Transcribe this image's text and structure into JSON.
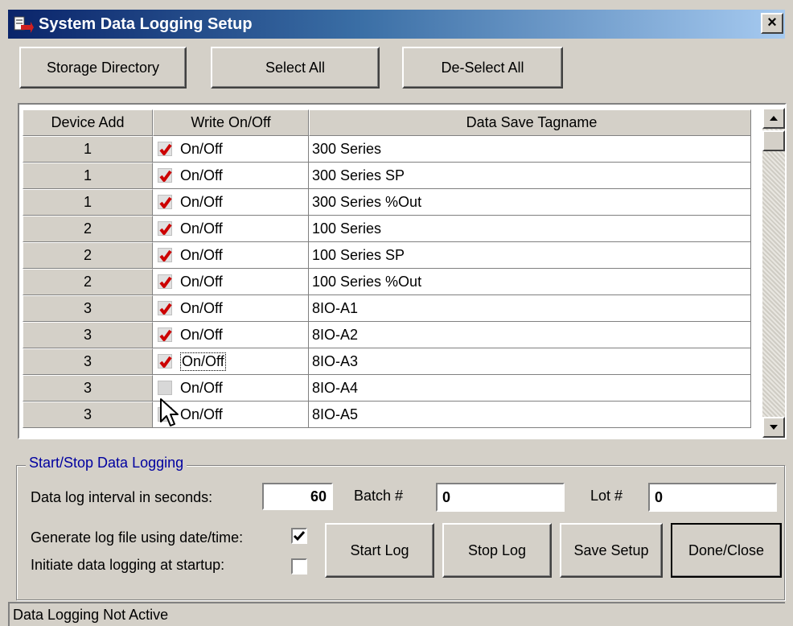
{
  "window": {
    "title": "System Data Logging Setup",
    "close_glyph": "×",
    "app_icon": "app-icon"
  },
  "toolbar": {
    "storage_directory": "Storage Directory",
    "select_all": "Select All",
    "deselect_all": "De-Select All"
  },
  "grid": {
    "headers": [
      "Device Add",
      "Write On/Off",
      "Data Save Tagname"
    ],
    "rows": [
      {
        "device": "1",
        "checked": true,
        "write": "On/Off",
        "tag": "300 Series"
      },
      {
        "device": "1",
        "checked": true,
        "write": "On/Off",
        "tag": "300 Series SP"
      },
      {
        "device": "1",
        "checked": true,
        "write": "On/Off",
        "tag": "300 Series %Out"
      },
      {
        "device": "2",
        "checked": true,
        "write": "On/Off",
        "tag": "100 Series"
      },
      {
        "device": "2",
        "checked": true,
        "write": "On/Off",
        "tag": "100 Series SP"
      },
      {
        "device": "2",
        "checked": true,
        "write": "On/Off",
        "tag": "100 Series %Out"
      },
      {
        "device": "3",
        "checked": true,
        "write": "On/Off",
        "tag": "8IO-A1"
      },
      {
        "device": "3",
        "checked": true,
        "write": "On/Off",
        "tag": "8IO-A2"
      },
      {
        "device": "3",
        "checked": true,
        "write": "On/Off",
        "tag": "8IO-A3"
      },
      {
        "device": "3",
        "checked": false,
        "write": "On/Off",
        "tag": "8IO-A4"
      },
      {
        "device": "3",
        "checked": false,
        "write": "On/Off",
        "tag": "8IO-A5"
      }
    ],
    "focused_row": 8,
    "check_color": "#cc0000"
  },
  "logging": {
    "group_title": "Start/Stop Data Logging",
    "interval_label": "Data log interval in seconds:",
    "interval_value": "60",
    "batch_label": "Batch #",
    "batch_value": "0",
    "lot_label": "Lot #",
    "lot_value": "0",
    "date_time_label": "Generate log file using date/time:",
    "date_time_checked": true,
    "startup_label": "Initiate data logging at startup:",
    "startup_checked": false,
    "start_log": "Start Log",
    "stop_log": "Stop Log",
    "save_setup": "Save Setup",
    "done_close": "Done/Close"
  },
  "status": {
    "text": "Data Logging Not Active"
  },
  "colors": {
    "title_start": "#0a246a",
    "title_end": "#a6caf0",
    "face": "#d4d0c8",
    "group_title": "#0000a0"
  }
}
